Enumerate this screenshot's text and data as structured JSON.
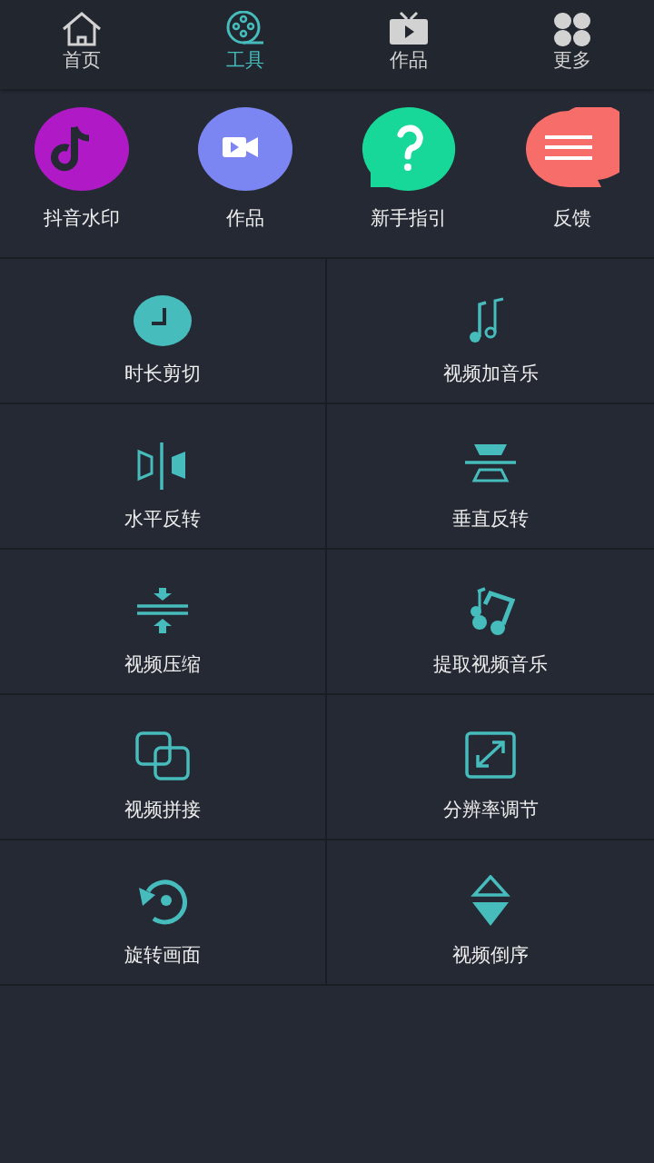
{
  "tabs": [
    {
      "label": "首页",
      "selected": false
    },
    {
      "label": "工具",
      "selected": true
    },
    {
      "label": "作品",
      "selected": false
    },
    {
      "label": "更多",
      "selected": false
    }
  ],
  "shortcuts": [
    {
      "label": "抖音水印",
      "color": "#b01ac6"
    },
    {
      "label": "作品",
      "color": "#7b86f3"
    },
    {
      "label": "新手指引",
      "color": "#17d898"
    },
    {
      "label": "反馈",
      "color": "#f76d6a"
    }
  ],
  "tools": [
    {
      "label": "时长剪切"
    },
    {
      "label": "视频加音乐"
    },
    {
      "label": "水平反转"
    },
    {
      "label": "垂直反转"
    },
    {
      "label": "视频压缩"
    },
    {
      "label": "提取视频音乐"
    },
    {
      "label": "视频拼接"
    },
    {
      "label": "分辨率调节"
    },
    {
      "label": "旋转画面"
    },
    {
      "label": "视频倒序"
    }
  ]
}
